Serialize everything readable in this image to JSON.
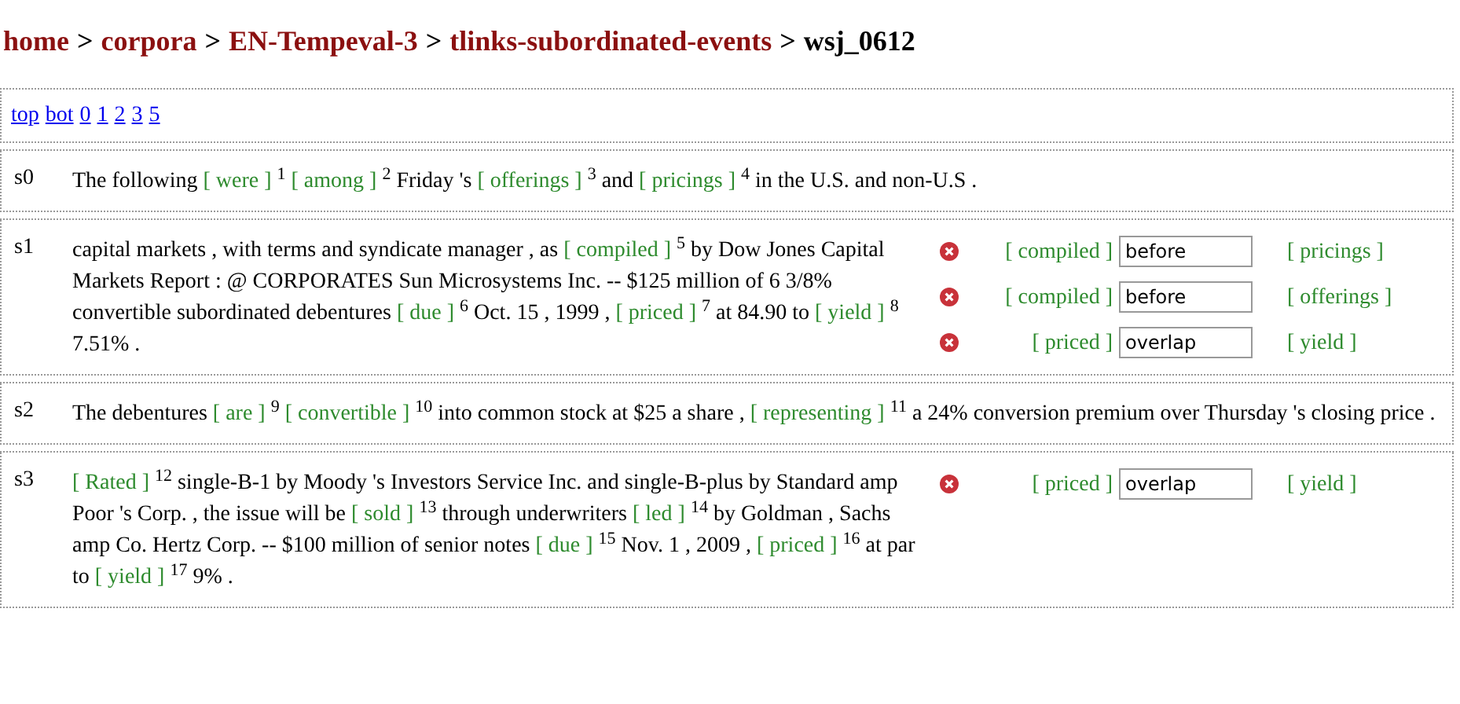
{
  "breadcrumb": [
    {
      "text": "home",
      "kind": "link"
    },
    {
      "text": "corpora",
      "kind": "link"
    },
    {
      "text": "EN-Tempeval-3",
      "kind": "link"
    },
    {
      "text": "tlinks-subordinated-events",
      "kind": "link"
    },
    {
      "text": "wsj_0612",
      "kind": "current"
    }
  ],
  "separator": ">",
  "nav_links": [
    "top",
    "bot",
    "0",
    "1",
    "2",
    "3",
    "5"
  ],
  "sentences": [
    {
      "id": "s0",
      "tokens": [
        {
          "kind": "text",
          "text": "The following"
        },
        {
          "kind": "event",
          "text": "[ were ]",
          "index": "1"
        },
        {
          "kind": "event",
          "text": "[ among ]",
          "index": "2"
        },
        {
          "kind": "text",
          "text": "Friday 's"
        },
        {
          "kind": "event",
          "text": "[ offerings ]",
          "index": "3"
        },
        {
          "kind": "text",
          "text": "and"
        },
        {
          "kind": "event",
          "text": "[ pricings ]",
          "index": "4"
        },
        {
          "kind": "text",
          "text": "in the U.S. and non-U.S ."
        }
      ]
    },
    {
      "id": "s1",
      "tokens": [
        {
          "kind": "text",
          "text": "capital markets , with terms and syndicate manager , as"
        },
        {
          "kind": "event",
          "text": "[ compiled ]",
          "index": "5"
        },
        {
          "kind": "text",
          "text": "by Dow Jones Capital Markets Report : @ CORPORATES Sun Microsystems Inc. -- $125 million of 6 3/8% convertible subordinated debentures"
        },
        {
          "kind": "event",
          "text": "[ due ]",
          "index": "6"
        },
        {
          "kind": "text",
          "text": "Oct. 15 , 1999 ,"
        },
        {
          "kind": "event",
          "text": "[ priced ]",
          "index": "7"
        },
        {
          "kind": "text",
          "text": "at 84.90 to"
        },
        {
          "kind": "event",
          "text": "[ yield ]",
          "index": "8"
        },
        {
          "kind": "text",
          "text": "7.51% ."
        }
      ],
      "links": [
        {
          "source": "[ compiled ]",
          "relation": "before",
          "target": "[ pricings ]"
        },
        {
          "source": "[ compiled ]",
          "relation": "before",
          "target": "[ offerings ]"
        },
        {
          "source": "[ priced ]",
          "relation": "overlap",
          "target": "[ yield ]"
        }
      ]
    },
    {
      "id": "s2",
      "tokens": [
        {
          "kind": "text",
          "text": "The debentures"
        },
        {
          "kind": "event",
          "text": "[ are ]",
          "index": "9"
        },
        {
          "kind": "event",
          "text": "[ convertible ]",
          "index": "10"
        },
        {
          "kind": "text",
          "text": "into common stock at $25 a share ,"
        },
        {
          "kind": "event",
          "text": "[ representing ]",
          "index": "11"
        },
        {
          "kind": "text",
          "text": "a 24% conversion premium over Thursday 's closing price ."
        }
      ]
    },
    {
      "id": "s3",
      "tokens": [
        {
          "kind": "event",
          "text": "[ Rated ]",
          "index": "12"
        },
        {
          "kind": "text",
          "text": "single-B-1 by Moody 's Investors Service Inc. and single-B-plus by Standard amp Poor 's Corp. , the issue will be"
        },
        {
          "kind": "event",
          "text": "[ sold ]",
          "index": "13"
        },
        {
          "kind": "text",
          "text": "through underwriters"
        },
        {
          "kind": "event",
          "text": "[ led ]",
          "index": "14"
        },
        {
          "kind": "text",
          "text": "by Goldman , Sachs amp Co. Hertz Corp. -- $100 million of senior notes"
        },
        {
          "kind": "event",
          "text": "[ due ]",
          "index": "15"
        },
        {
          "kind": "text",
          "text": "Nov. 1 , 2009 ,"
        },
        {
          "kind": "event",
          "text": "[ priced ]",
          "index": "16"
        },
        {
          "kind": "text",
          "text": "at par to"
        },
        {
          "kind": "event",
          "text": "[ yield ]",
          "index": "17"
        },
        {
          "kind": "text",
          "text": "9% ."
        }
      ],
      "links": [
        {
          "source": "[ priced ]",
          "relation": "overlap",
          "target": "[ yield ]"
        }
      ]
    }
  ]
}
